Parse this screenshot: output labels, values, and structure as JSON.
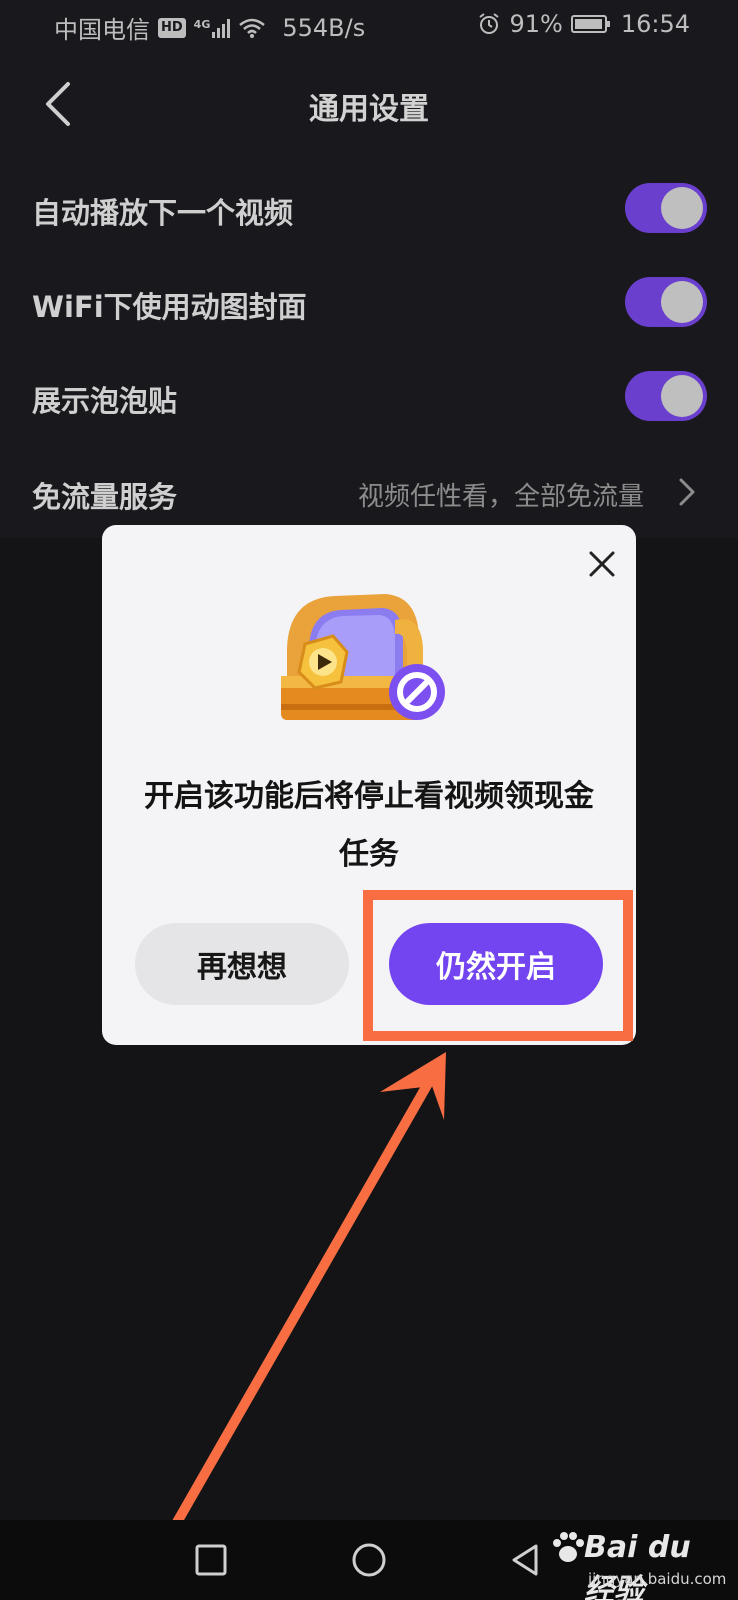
{
  "status_bar": {
    "carrier": "中国电信",
    "hd": "HD",
    "network": "4G",
    "speed": "554B/s",
    "battery": "91%",
    "time": "16:54"
  },
  "header": {
    "title": "通用设置"
  },
  "settings": [
    {
      "label": "自动播放下一个视频",
      "toggle_on": true
    },
    {
      "label": "WiFi下使用动图封面",
      "toggle_on": true
    },
    {
      "label": "展示泡泡贴",
      "toggle_on": true
    }
  ],
  "data_saver": {
    "label": "免流量服务",
    "value": "视频任性看，全部免流量"
  },
  "dialog": {
    "message": "开启该功能后将停止看视频领现金任务",
    "cancel_label": "再想想",
    "confirm_label": "仍然开启"
  },
  "watermark": {
    "brand": "Bai du 经验",
    "url": "jingyan.baidu.com"
  },
  "colors": {
    "accent": "#7345f0",
    "toggle_track": "#6a3fce",
    "annotation": "#f86e42"
  }
}
